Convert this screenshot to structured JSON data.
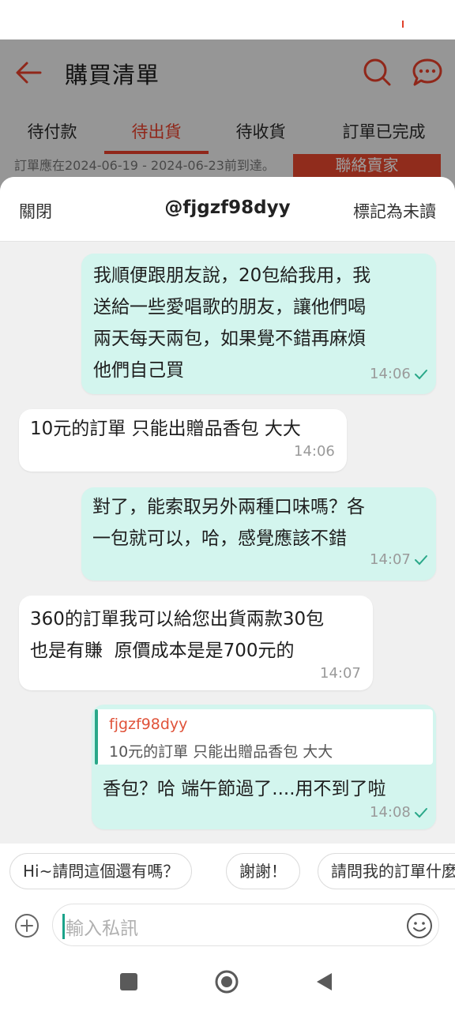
{
  "background_page": {
    "title": "購買清單",
    "tabs": [
      {
        "label": "待付款",
        "active": false
      },
      {
        "label": "待出貨",
        "active": true
      },
      {
        "label": "待收貨",
        "active": false
      },
      {
        "label": "訂單已完成",
        "active": false
      }
    ],
    "order_note": "訂單應在2024-06-19 - 2024-06-23前到達。",
    "contact_seller": "聯絡賣家"
  },
  "chat": {
    "close_label": "關閉",
    "title": "@fjgzf98dyy",
    "mark_unread_label": "標記為未讀",
    "messages": [
      {
        "sender": "me",
        "text": "我順便跟朋友說，20包給我用，我\n送給一些愛唱歌的朋友，讓他們喝\n兩天每天兩包，如果覺不錯再麻煩\n他們自己買",
        "time": "14:06",
        "read": true
      },
      {
        "sender": "them",
        "text": "10元的訂單 只能出贈品香包 大大",
        "time": "14:06"
      },
      {
        "sender": "me",
        "text": "對了，能索取另外兩種口味嗎？各\n一包就可以，哈，感覺應該不錯",
        "time": "14:07",
        "read": true
      },
      {
        "sender": "them",
        "text": "360的訂單我可以給您出貨兩款30包\n也是有賺  原價成本是是700元的",
        "time": "14:07"
      },
      {
        "sender": "me",
        "quote": {
          "name": "fjgzf98dyy",
          "text": "10元的訂單 只能出贈品香包 大大"
        },
        "text": "香包？哈 端午節過了....用不到了啦",
        "time": "14:08",
        "read": true
      }
    ],
    "quick_replies": [
      "Hi~請問這個還有嗎？",
      "謝謝！",
      "請問我的訂單什麼時候會出貨"
    ],
    "input_placeholder": "輸入私訊"
  },
  "colors": {
    "accent": "#e8402a",
    "my_bubble": "#d3f5ee",
    "their_bubble": "#ffffff",
    "read_tick": "#2aa889"
  },
  "icons": [
    "back-arrow-icon",
    "search-icon",
    "chat-icon",
    "add-icon",
    "emoji-icon",
    "read-check-icon",
    "nav-recents-icon",
    "nav-home-icon",
    "nav-back-icon"
  ]
}
